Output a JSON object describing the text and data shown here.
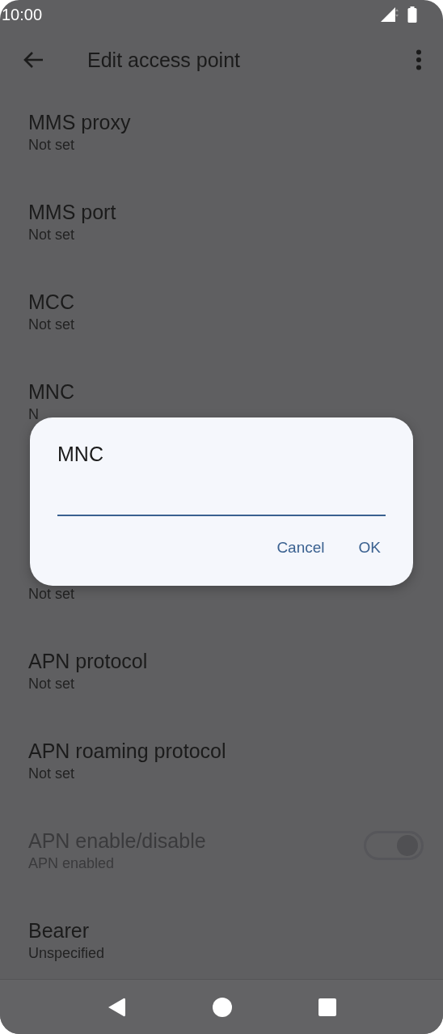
{
  "status_bar": {
    "time": "10:00"
  },
  "app_bar": {
    "title": "Edit access point"
  },
  "items": [
    {
      "kind": "text",
      "title": "MMS proxy",
      "summary": "Not set",
      "disabled": false
    },
    {
      "kind": "text",
      "title": "MMS port",
      "summary": "Not set",
      "disabled": false
    },
    {
      "kind": "text",
      "title": "MCC",
      "summary": "Not set",
      "disabled": false
    },
    {
      "kind": "text",
      "title": "MNC",
      "summary": "N",
      "disabled": false
    },
    {
      "kind": "covered"
    },
    {
      "kind": "text",
      "summary": "Not set",
      "disabled": false
    },
    {
      "kind": "text",
      "title": "APN protocol",
      "summary": "Not set",
      "disabled": false
    },
    {
      "kind": "text",
      "title": "APN roaming protocol",
      "summary": "Not set",
      "disabled": false
    },
    {
      "kind": "switch",
      "title": "APN enable/disable",
      "summary": "APN enabled",
      "disabled": true,
      "on": true
    },
    {
      "kind": "text",
      "title": "Bearer",
      "summary": "Unspecified",
      "disabled": false
    }
  ],
  "dialog": {
    "title": "MNC",
    "buttons": [
      "Cancel",
      "OK"
    ]
  }
}
